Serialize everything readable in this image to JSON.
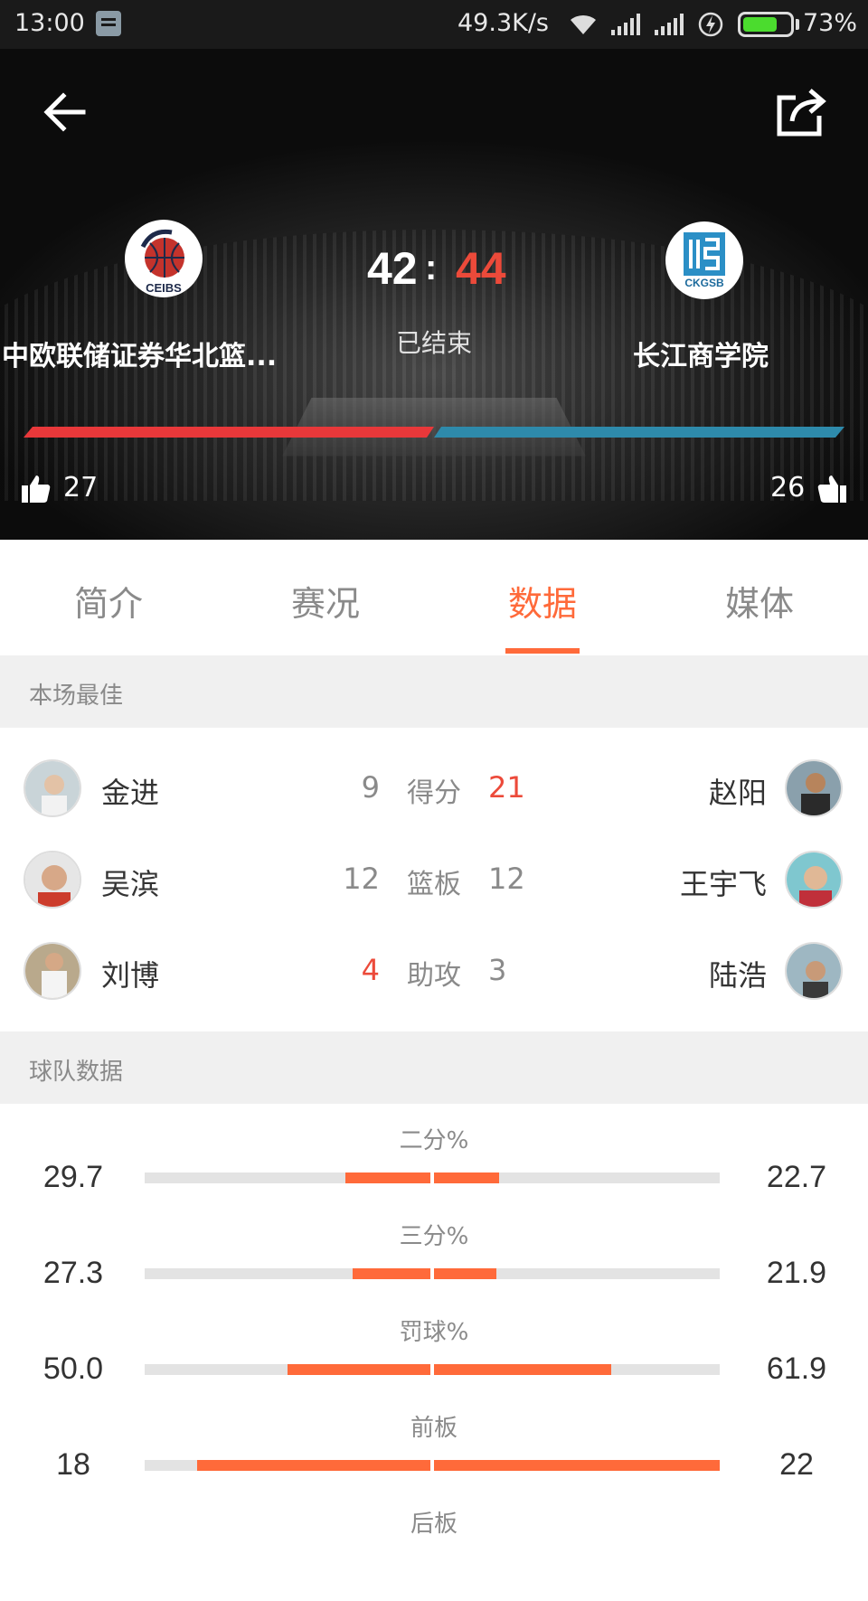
{
  "status_bar": {
    "time": "13:00",
    "net_speed": "49.3K/s",
    "battery_percent": "73%",
    "battery_level": 0.73
  },
  "hero": {
    "home_team": {
      "name": "中欧联储证券华北篮...",
      "logo_text": "CEIBS",
      "score": "42",
      "likes": "27"
    },
    "away_team": {
      "name": "长江商学院",
      "logo_text": "CKGSB",
      "score": "44",
      "likes": "26"
    },
    "score_separator": ":",
    "game_status": "已结束",
    "colors": {
      "home": "#e8383a",
      "away": "#2e8aab",
      "away_score": "#ec4a3a"
    }
  },
  "tabs": [
    {
      "label": "简介",
      "active": false
    },
    {
      "label": "赛况",
      "active": false
    },
    {
      "label": "数据",
      "active": true
    },
    {
      "label": "媒体",
      "active": false
    }
  ],
  "best_players": {
    "title": "本场最佳",
    "rows": [
      {
        "stat": "得分",
        "home_player": "金进",
        "home_value": "9",
        "away_player": "赵阳",
        "away_value": "21"
      },
      {
        "stat": "篮板",
        "home_player": "吴滨",
        "home_value": "12",
        "away_player": "王宇飞",
        "away_value": "12"
      },
      {
        "stat": "助攻",
        "home_player": "刘博",
        "home_value": "4",
        "away_player": "陆浩",
        "away_value": "3"
      }
    ]
  },
  "team_stats": {
    "title": "球队数据",
    "rows": [
      {
        "label": "二分%",
        "home": "29.7",
        "away": "22.7",
        "home_fill": 0.297,
        "away_fill": 0.227
      },
      {
        "label": "三分%",
        "home": "27.3",
        "away": "21.9",
        "home_fill": 0.273,
        "away_fill": 0.219
      },
      {
        "label": "罚球%",
        "home": "50.0",
        "away": "61.9",
        "home_fill": 0.5,
        "away_fill": 0.619
      },
      {
        "label": "前板",
        "home": "18",
        "away": "22",
        "home_fill": 0.818,
        "away_fill": 1.0
      },
      {
        "label": "后板"
      }
    ]
  },
  "accent_color": "#ff6a3a"
}
